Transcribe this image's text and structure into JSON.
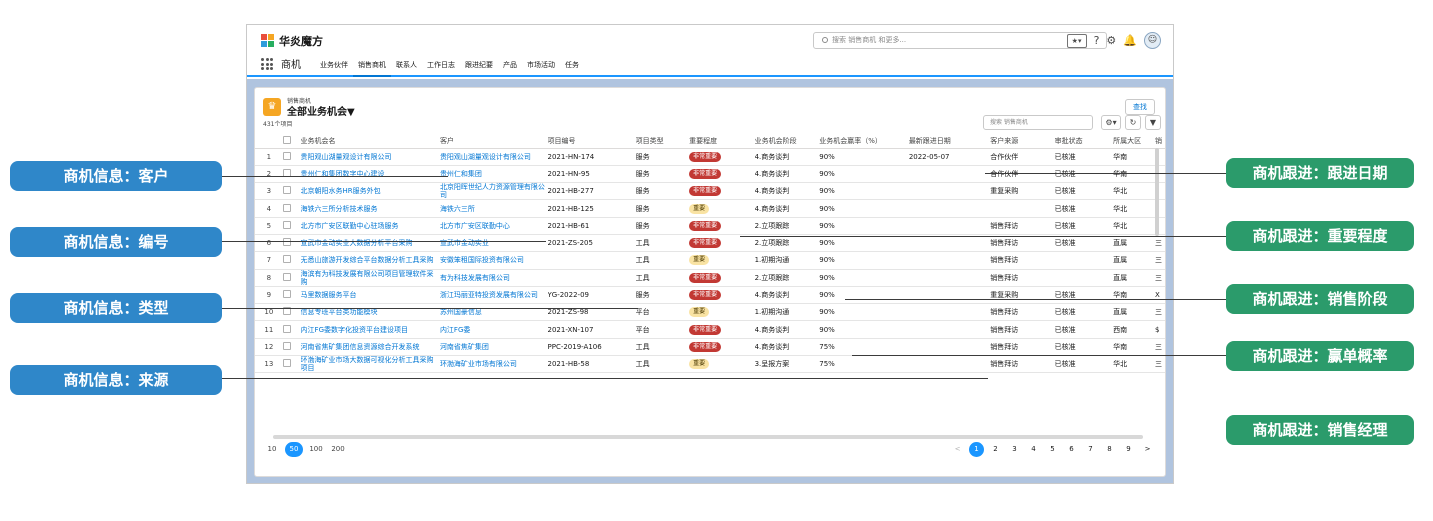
{
  "app": {
    "name": "华炎魔方",
    "search_placeholder": "搜索 销售商机 和更多..."
  },
  "nav": {
    "app_label": "商机",
    "tabs": [
      "业务伙伴",
      "销售商机",
      "联系人",
      "工作日志",
      "跟进纪要",
      "产品",
      "市场活动",
      "任务"
    ],
    "active_tab": "销售商机"
  },
  "list": {
    "object_label": "销售商机",
    "view_name": "全部业务机会▼",
    "count": "431个项目",
    "new_button": "查找",
    "search_placeholder": "搜索 销售商机",
    "columns": [
      "",
      "",
      "业务机会名",
      "客户",
      "项目编号",
      "项目类型",
      "重要程度",
      "业务机会阶段",
      "业务机会赢率（%）",
      "最新跟进日期",
      "客户来源",
      "审批状态",
      "所属大区",
      "销"
    ],
    "rows": [
      {
        "n": "1",
        "name": "贵阳观山湖量观设计有限公司",
        "customer": "贵阳观山湖量观设计有限公司",
        "code": "2021-HN-174",
        "type": "服务",
        "level": "非常重要",
        "stage": "4.商务谈判",
        "rate": "90%",
        "date": "2022-05-07",
        "source": "合作伙伴",
        "status": "已核准",
        "region": "华南",
        "extra": ""
      },
      {
        "n": "2",
        "name": "贵州仁和集团数字中心建设",
        "customer": "贵州仁和集团",
        "code": "2021-HN-95",
        "type": "服务",
        "level": "非常重要",
        "stage": "4.商务谈判",
        "rate": "90%",
        "date": "",
        "source": "合作伙伴",
        "status": "已核准",
        "region": "华南",
        "extra": ""
      },
      {
        "n": "3",
        "name": "北京朝阳水务HR服务外包",
        "customer": "北京阳晖世纪人力资源管理有限公司",
        "code": "2021-HB-277",
        "type": "服务",
        "level": "非常重要",
        "stage": "4.商务谈判",
        "rate": "90%",
        "date": "",
        "source": "重复采购",
        "status": "已核准",
        "region": "华北",
        "extra": ""
      },
      {
        "n": "4",
        "name": "海铁六三所分析技术服务",
        "customer": "海铁六三所",
        "code": "2021-HB-125",
        "type": "服务",
        "level": "重要",
        "stage": "4.商务谈判",
        "rate": "90%",
        "date": "",
        "source": "",
        "status": "已核准",
        "region": "华北",
        "extra": ""
      },
      {
        "n": "5",
        "name": "北方市广安区联勤中心驻场服务",
        "customer": "北方市广安区联勤中心",
        "code": "2021-HB-61",
        "type": "服务",
        "level": "非常重要",
        "stage": "2.立项跟踪",
        "rate": "90%",
        "date": "",
        "source": "销售拜访",
        "status": "已核准",
        "region": "华北",
        "extra": ""
      },
      {
        "n": "6",
        "name": "宣武市金动实业大数据分析平台采购",
        "customer": "宣武市金动实业",
        "code": "2021-ZS-205",
        "type": "工具",
        "level": "非常重要",
        "stage": "2.立项跟踪",
        "rate": "90%",
        "date": "",
        "source": "销售拜访",
        "status": "已核准",
        "region": "直属",
        "extra": "三"
      },
      {
        "n": "7",
        "name": "无悉山旅游开发综合平台数据分析工具采购",
        "customer": "安徽笨租国际投资有限公司",
        "code": "",
        "type": "工具",
        "level": "重要",
        "stage": "1.初期沟通",
        "rate": "90%",
        "date": "",
        "source": "销售拜访",
        "status": "",
        "region": "直属",
        "extra": "三"
      },
      {
        "n": "8",
        "name": "海滨有为科技发展有限公司项目管理软件采购",
        "customer": "有为科技发展有限公司",
        "code": "",
        "type": "工具",
        "level": "非常重要",
        "stage": "2.立项跟踪",
        "rate": "90%",
        "date": "",
        "source": "销售拜访",
        "status": "",
        "region": "直属",
        "extra": "三"
      },
      {
        "n": "9",
        "name": "马里数据服务平台",
        "customer": "浙江玛丽亚特投资发展有限公司",
        "code": "YG-2022-09",
        "type": "服务",
        "level": "非常重要",
        "stage": "4.商务谈判",
        "rate": "90%",
        "date": "",
        "source": "重复采购",
        "status": "已核准",
        "region": "华南",
        "extra": "X"
      },
      {
        "n": "10",
        "name": "信息专班平台类功能模块",
        "customer": "苏州国豪信息",
        "code": "2021-ZS-98",
        "type": "平台",
        "level": "重要",
        "stage": "1.初期沟通",
        "rate": "90%",
        "date": "",
        "source": "销售拜访",
        "status": "已核准",
        "region": "直属",
        "extra": "三"
      },
      {
        "n": "11",
        "name": "内江FG委数字化投资平台建设项目",
        "customer": "内江FG委",
        "code": "2021-XN-107",
        "type": "平台",
        "level": "非常重要",
        "stage": "4.商务谈判",
        "rate": "90%",
        "date": "",
        "source": "销售拜访",
        "status": "已核准",
        "region": "西南",
        "extra": "$"
      },
      {
        "n": "12",
        "name": "河南省焦矿集团信息资源综合开发系统",
        "customer": "河南省焦矿集团",
        "code": "PPC-2019-A106",
        "type": "工具",
        "level": "非常重要",
        "stage": "4.商务谈判",
        "rate": "75%",
        "date": "",
        "source": "销售拜访",
        "status": "已核准",
        "region": "华南",
        "extra": "三"
      },
      {
        "n": "13",
        "name": "环渤海矿业市场大数据可视化分析工具采购项目",
        "customer": "环渤海矿业市场有限公司",
        "code": "2021-HB-58",
        "type": "工具",
        "level": "重要",
        "stage": "3.呈报方案",
        "rate": "75%",
        "date": "",
        "source": "销售拜访",
        "status": "已核准",
        "region": "华北",
        "extra": "三"
      }
    ]
  },
  "pager": {
    "sizes": [
      "10",
      "50",
      "100",
      "200"
    ],
    "active_size": "50",
    "prev": "<",
    "pages": [
      "1",
      "2",
      "3",
      "4",
      "5",
      "6",
      "7",
      "8",
      "9"
    ],
    "active_page": "1",
    "next": ">"
  },
  "callouts_left": [
    "商机信息：客户",
    "商机信息：编号",
    "商机信息：类型",
    "商机信息：来源"
  ],
  "callouts_right": [
    "商机跟进：跟进日期",
    "商机跟进：重要程度",
    "商机跟进：销售阶段",
    "商机跟进：赢单概率",
    "商机跟进：销售经理"
  ],
  "colors": {
    "brand_blue": "#0176d3",
    "list_background": "#b0c4df",
    "tag_red": "#c23934",
    "tag_yellow": "#f9e3a3",
    "callout_blue": "#2f87c9",
    "callout_green": "#2b9b6b"
  },
  "icons": [
    "waffle-icon",
    "search-icon",
    "favorites-icon",
    "help-icon",
    "setup-gear-icon",
    "notification-bell-icon",
    "avatar",
    "crown-icon",
    "settings-icon",
    "refresh-icon",
    "filter-icon"
  ]
}
